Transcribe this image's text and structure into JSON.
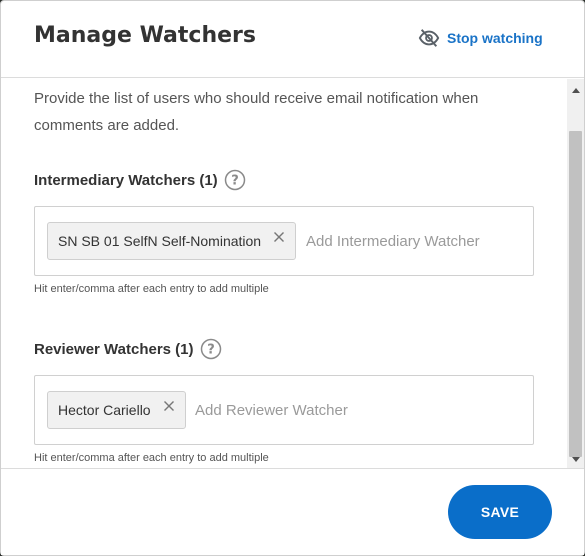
{
  "dialog": {
    "title": "Manage Watchers",
    "stop_watching_label": "Stop watching",
    "description": "Provide the list of users who should receive email notification when comments are added."
  },
  "intermediary": {
    "label": "Intermediary Watchers (1)",
    "chips": [
      "SN SB 01 SelfN Self-Nomination"
    ],
    "placeholder": "Add Intermediary Watcher",
    "hint": "Hit enter/comma after each entry to add multiple"
  },
  "reviewer": {
    "label": "Reviewer Watchers (1)",
    "chips": [
      "Hector Cariello"
    ],
    "placeholder": "Add Reviewer Watcher",
    "hint": "Hit enter/comma after each entry to add multiple"
  },
  "footer": {
    "save_label": "SAVE"
  },
  "icons": {
    "stop_watching": "eye-slash-icon",
    "help": "question-circle-icon",
    "chip_remove": "close-icon"
  },
  "colors": {
    "accent": "#1a73c7",
    "save_button": "#0a6ec9"
  }
}
